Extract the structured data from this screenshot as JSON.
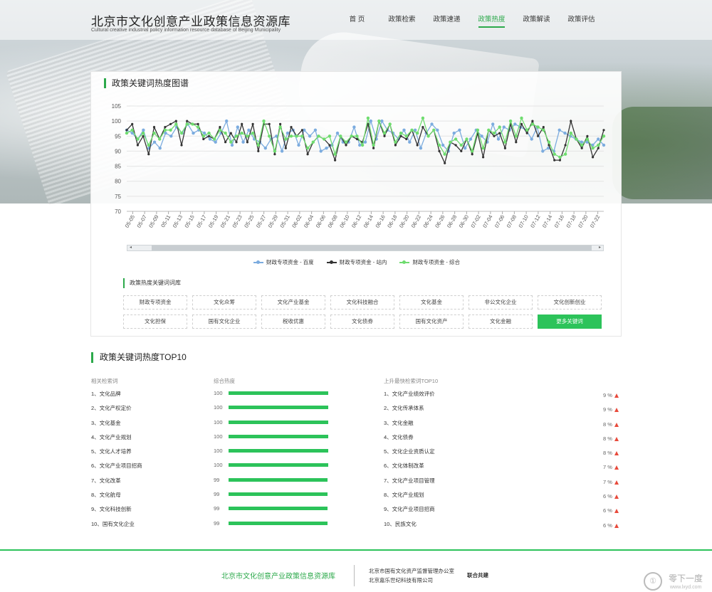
{
  "header": {
    "title": "北京市文化创意产业政策信息资源库",
    "subtitle": "Cultural creative industrial policy information resource database of Beijing Municipality",
    "nav": [
      {
        "label": "首 页",
        "active": false
      },
      {
        "label": "政策检索",
        "active": false
      },
      {
        "label": "政策速递",
        "active": false
      },
      {
        "label": "政策热度",
        "active": true
      },
      {
        "label": "政策解读",
        "active": false
      },
      {
        "label": "政策评估",
        "active": false
      }
    ]
  },
  "chart_panel": {
    "title": "政策关键词热度图谱",
    "scroll_left": "◂",
    "scroll_right": "▸"
  },
  "chart_data": {
    "type": "line",
    "ylim": [
      70,
      105
    ],
    "yticks": [
      70,
      75,
      80,
      85,
      90,
      95,
      100,
      105
    ],
    "grid": true,
    "legend_position": "bottom",
    "x_tick_labels": [
      "05-05",
      "05-07",
      "05-09",
      "05-11",
      "05-13",
      "05-15",
      "05-17",
      "05-19",
      "05-21",
      "05-23",
      "05-25",
      "05-27",
      "05-29",
      "05-31",
      "06-02",
      "06-04",
      "06-06",
      "06-08",
      "06-10",
      "06-12",
      "06-14",
      "06-16",
      "06-18",
      "06-20",
      "06-22",
      "06-24",
      "06-26",
      "06-28",
      "06-30",
      "07-02",
      "07-04",
      "07-06",
      "07-08",
      "07-10",
      "07-12",
      "07-14",
      "07-16",
      "07-18",
      "07-20",
      "07-22"
    ],
    "series": [
      {
        "name": "财政专项资金 - 百度",
        "color": "#7cacdf",
        "values": [
          97,
          96,
          94,
          97,
          91,
          93,
          91,
          96,
          95,
          98,
          96,
          99,
          96,
          97,
          96,
          94,
          93,
          96,
          100,
          92,
          98,
          93,
          97,
          94,
          93,
          91,
          94,
          95,
          90,
          96,
          97,
          92,
          97,
          95,
          97,
          90,
          91,
          92,
          96,
          93,
          93,
          98,
          92,
          93,
          100,
          94,
          100,
          97,
          96,
          94,
          97,
          93,
          97,
          91,
          96,
          99,
          97,
          92,
          90,
          96,
          97,
          91,
          94,
          97,
          95,
          93,
          99,
          94,
          98,
          97,
          99,
          98,
          97,
          94,
          98,
          90,
          91,
          90,
          97,
          96,
          95,
          94,
          93,
          93,
          92,
          94,
          92
        ]
      },
      {
        "name": "财政专项资金 - 站内",
        "color": "#333333",
        "values": [
          97,
          99,
          92,
          95,
          89,
          98,
          94,
          98,
          99,
          100,
          92,
          100,
          99,
          99,
          94,
          95,
          94,
          98,
          93,
          96,
          93,
          99,
          93,
          99,
          90,
          99,
          99,
          89,
          99,
          91,
          98,
          95,
          97,
          89,
          93,
          95,
          94,
          92,
          87,
          95,
          92,
          95,
          94,
          93,
          99,
          91,
          100,
          95,
          99,
          92,
          95,
          94,
          97,
          92,
          98,
          95,
          97,
          90,
          86,
          93,
          92,
          90,
          94,
          89,
          96,
          88,
          97,
          95,
          96,
          91,
          99,
          93,
          99,
          96,
          100,
          95,
          98,
          92,
          87,
          87,
          92,
          100,
          94,
          91,
          95,
          88,
          91,
          97
        ]
      },
      {
        "name": "财政专项资金 - 综合",
        "color": "#6fdc6f",
        "values": [
          96,
          97,
          94,
          96,
          92,
          96,
          94,
          97,
          97,
          99,
          96,
          99,
          99,
          98,
          95,
          96,
          94,
          97,
          96,
          93,
          95,
          96,
          95,
          96,
          92,
          100,
          95,
          90,
          98,
          94,
          95,
          95,
          95,
          91,
          93,
          95,
          94,
          95,
          89,
          95,
          93,
          95,
          95,
          92,
          101,
          92,
          100,
          96,
          99,
          93,
          96,
          95,
          97,
          96,
          101,
          95,
          97,
          92,
          89,
          93,
          94,
          92,
          94,
          90,
          97,
          91,
          97,
          96,
          98,
          93,
          100,
          95,
          101,
          97,
          99,
          98,
          97,
          93,
          89,
          88,
          89,
          96,
          94,
          92,
          94,
          91,
          92,
          95
        ]
      }
    ]
  },
  "keywords": {
    "title": "政策热度关键词词库",
    "items": [
      "财政专项资金",
      "文化众筹",
      "文化产业基金",
      "文化科技融合",
      "文化基金",
      "非公文化企业",
      "文化创新创业",
      "文化担保",
      "国有文化企业",
      "税收优惠",
      "文化债券",
      "国有文化资产",
      "文化金融"
    ],
    "more_label": "更多关键词"
  },
  "top10": {
    "title": "政策关键词热度TOP10",
    "col_related": "相关检索词",
    "col_heat": "综合热度",
    "col_rise": "上升最快检索词TOP10",
    "ranking": [
      {
        "label": "1、文化品牌",
        "value": 100
      },
      {
        "label": "2、文化产权定价",
        "value": 100
      },
      {
        "label": "3、文化基金",
        "value": 100
      },
      {
        "label": "4、文化产业规划",
        "value": 100
      },
      {
        "label": "5、文化人才培养",
        "value": 100
      },
      {
        "label": "6、文化产业项目招商",
        "value": 100
      },
      {
        "label": "7、文化改革",
        "value": 99
      },
      {
        "label": "8、文化航母",
        "value": 99
      },
      {
        "label": "9、文化科技创新",
        "value": 99
      },
      {
        "label": "10、国有文化企业",
        "value": 99
      }
    ],
    "rising": [
      {
        "label": "1、文化产业绩效评价",
        "pct": "9 %"
      },
      {
        "label": "2、文化传承体系",
        "pct": "9 %"
      },
      {
        "label": "3、文化金融",
        "pct": "8 %"
      },
      {
        "label": "4、文化债券",
        "pct": "8 %"
      },
      {
        "label": "5、文化企业资质认定",
        "pct": "8 %"
      },
      {
        "label": "6、文化体制改革",
        "pct": "7 %"
      },
      {
        "label": "7、文化产业项目管理",
        "pct": "7 %"
      },
      {
        "label": "8、文化产业规划",
        "pct": "6 %"
      },
      {
        "label": "9、文化产业项目招商",
        "pct": "6 %"
      },
      {
        "label": "10、民族文化",
        "pct": "6 %"
      }
    ]
  },
  "footer": {
    "name": "北京市文化创意产业政策信息资源库",
    "org1": "北京市国有文化资产监督管理办公室",
    "org2": "北京嘉乐世纪科技有限公司",
    "joint": "联合共建",
    "watermark_logo": "①",
    "watermark_name": "零下一度",
    "watermark_url": "www.lxyd.com"
  },
  "colors": {
    "accent": "#2ca94b",
    "bar": "#2cc35a",
    "up_arrow": "#e84a3b"
  }
}
